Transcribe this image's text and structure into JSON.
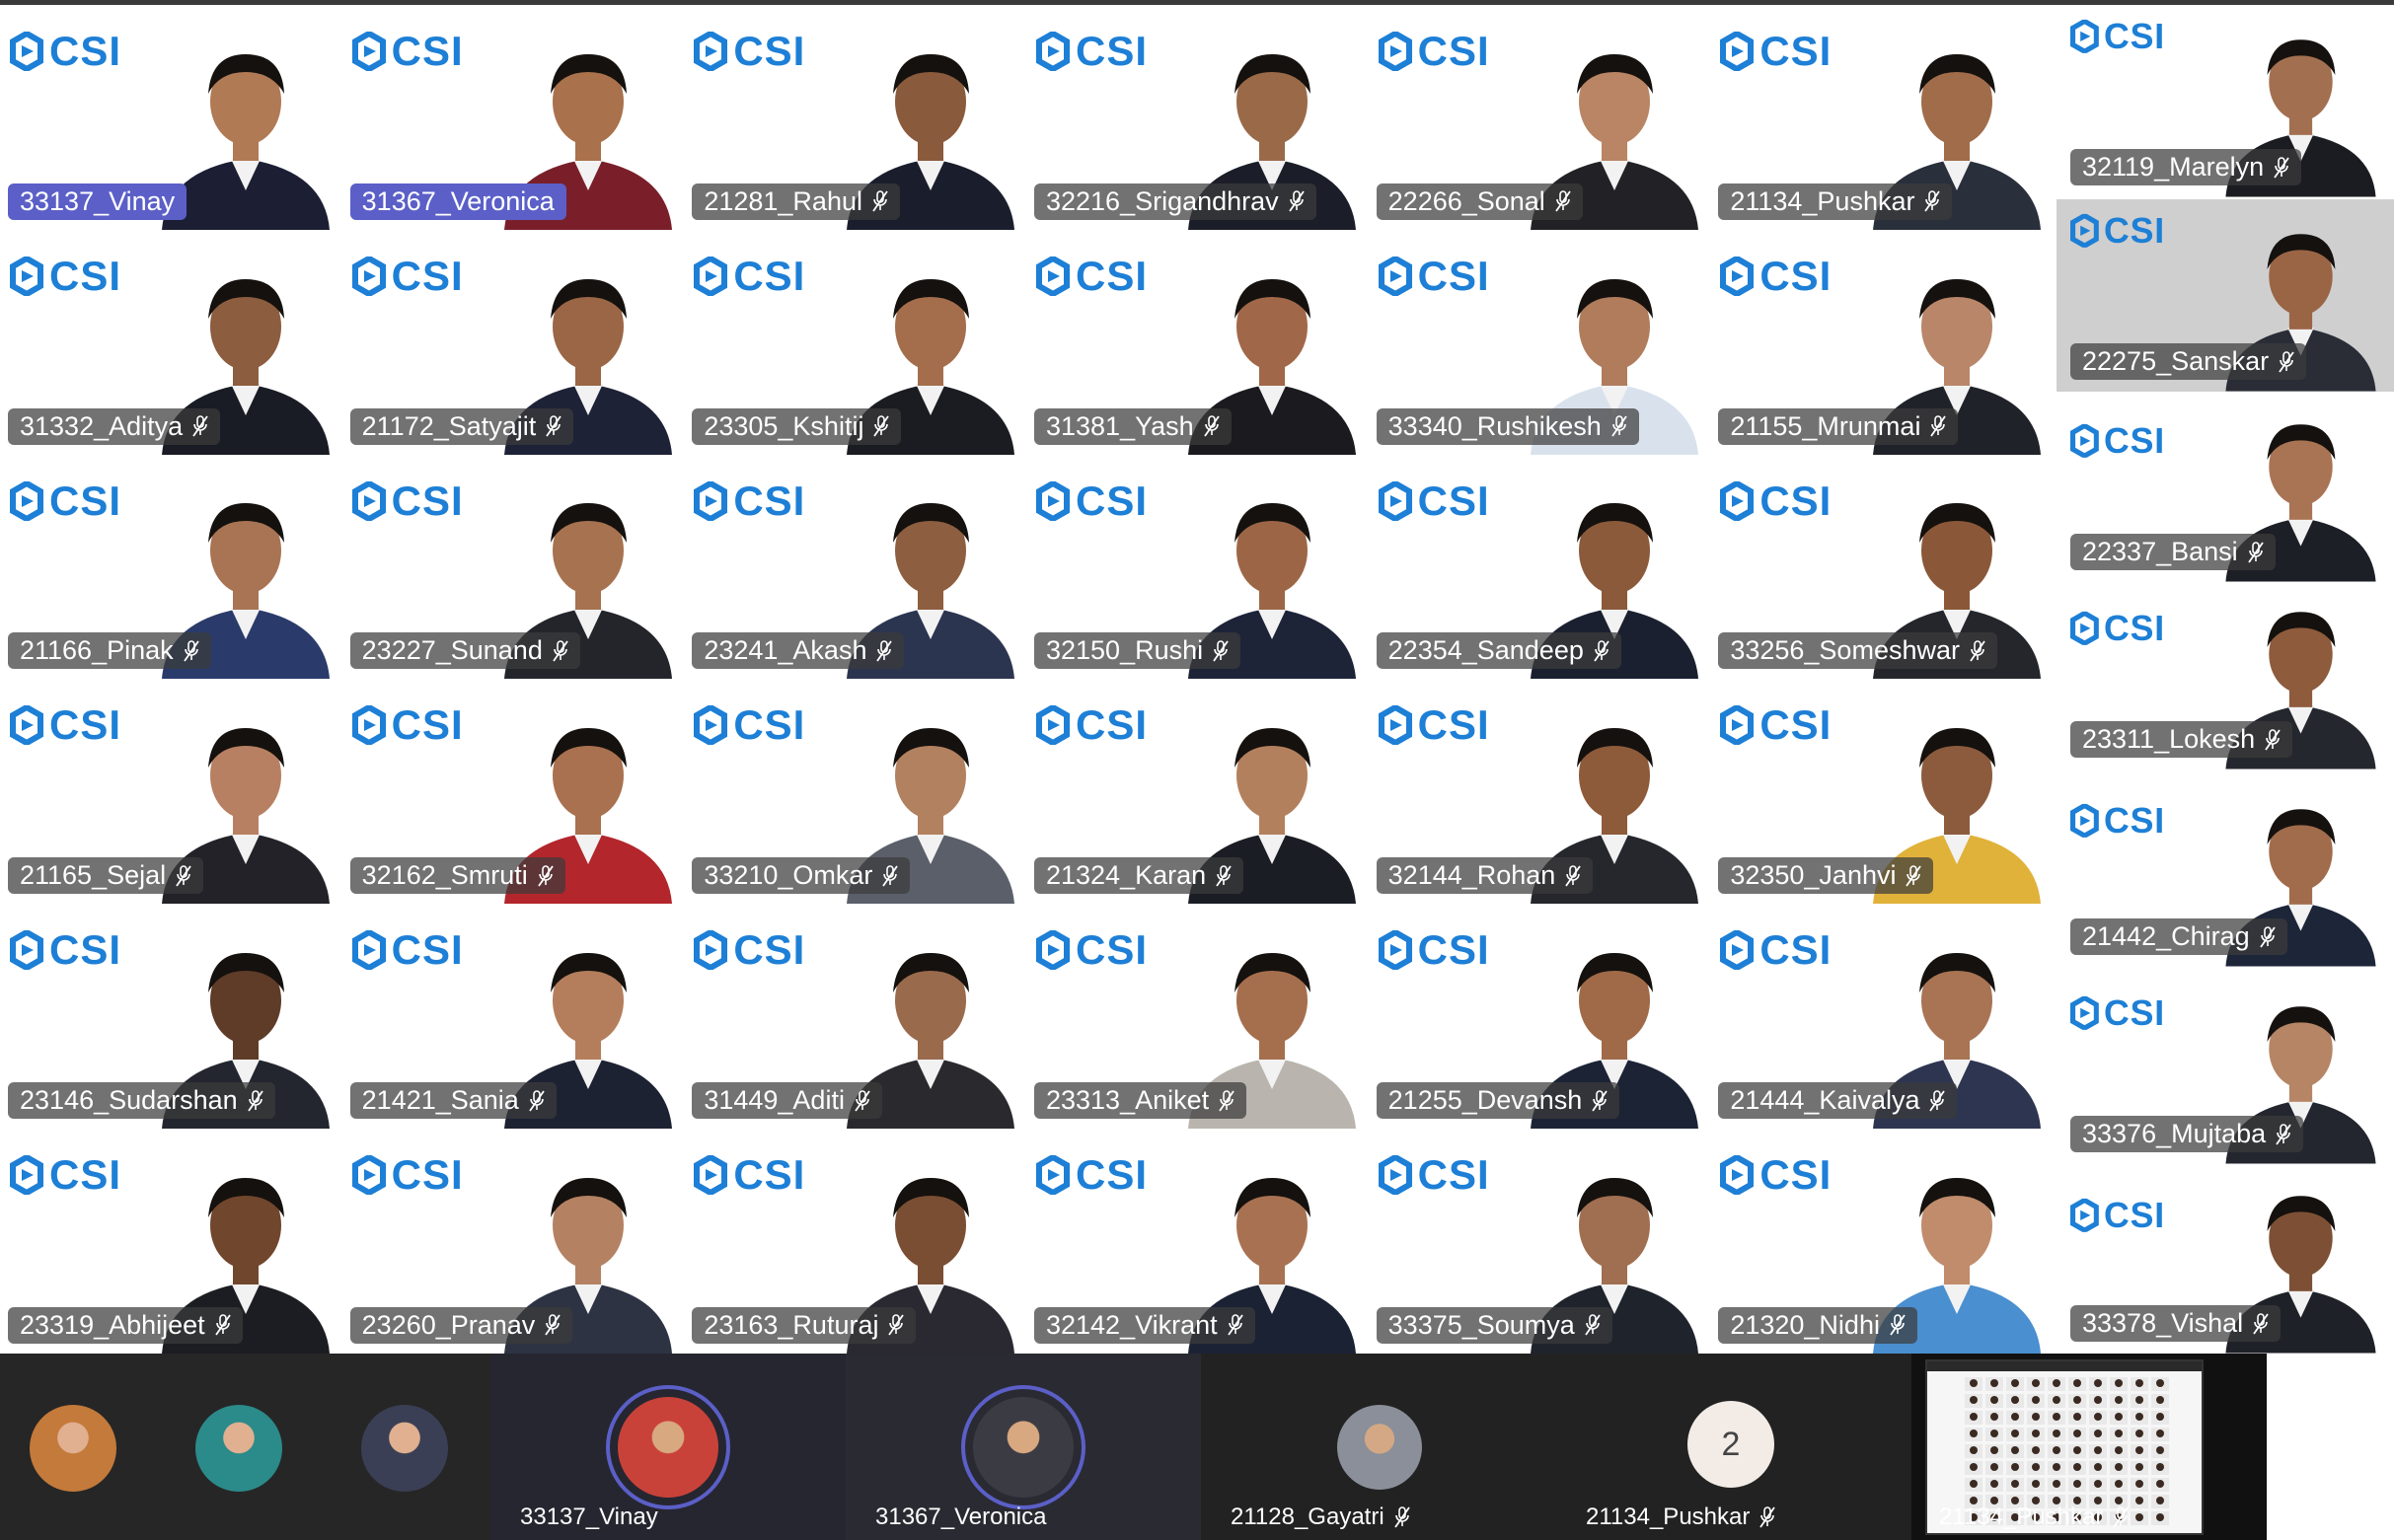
{
  "brand": {
    "logo_text": "CSI",
    "logo_color": "#1d7fd6",
    "speaking_color": "#5b5fc7"
  },
  "grid": [
    {
      "name": "33137_Vinay",
      "speaking": true,
      "muted": false,
      "shirt": "#1c1f33",
      "skin": "#b07a55"
    },
    {
      "name": "31367_Veronica",
      "speaking": true,
      "muted": false,
      "shirt": "#7a1f2a",
      "skin": "#a9714c"
    },
    {
      "name": "21281_Rahul",
      "speaking": false,
      "muted": true,
      "shirt": "#1a1e2c",
      "skin": "#8a5a3c"
    },
    {
      "name": "32216_Srigandhrav",
      "speaking": false,
      "muted": true,
      "shirt": "#1b1e28",
      "skin": "#9a6a48"
    },
    {
      "name": "22266_Sonal",
      "speaking": false,
      "muted": true,
      "shirt": "#222226",
      "skin": "#b98564"
    },
    {
      "name": "21134_Pushkar",
      "speaking": false,
      "muted": true,
      "shirt": "#2a2f3c",
      "skin": "#a06c4a"
    },
    {
      "name": "31332_Aditya",
      "speaking": false,
      "muted": true,
      "shirt": "#191c24",
      "skin": "#8c5d3f"
    },
    {
      "name": "21172_Satyajit",
      "speaking": false,
      "muted": true,
      "shirt": "#1d2236",
      "skin": "#9a6646"
    },
    {
      "name": "23305_Kshitij",
      "speaking": false,
      "muted": true,
      "shirt": "#1a1c22",
      "skin": "#a46e4c"
    },
    {
      "name": "31381_Yash",
      "speaking": false,
      "muted": true,
      "shirt": "#1a1a1f",
      "skin": "#a06848"
    },
    {
      "name": "33340_Rushikesh",
      "speaking": false,
      "muted": true,
      "shirt": "#d9e2ec",
      "skin": "#b07c5c"
    },
    {
      "name": "21155_Mrunmai",
      "speaking": false,
      "muted": true,
      "shirt": "#20222a",
      "skin": "#b9866a"
    },
    {
      "name": "21166_Pinak",
      "speaking": false,
      "muted": true,
      "shirt": "#2a3a6a",
      "skin": "#a87453"
    },
    {
      "name": "23227_Sunand",
      "speaking": false,
      "muted": true,
      "shirt": "#23252b",
      "skin": "#a77250"
    },
    {
      "name": "23241_Akash",
      "speaking": false,
      "muted": true,
      "shirt": "#2b3550",
      "skin": "#8e5e40"
    },
    {
      "name": "32150_Rushi",
      "speaking": false,
      "muted": true,
      "shirt": "#1d2438",
      "skin": "#9c6646"
    },
    {
      "name": "22354_Sandeep",
      "speaking": false,
      "muted": true,
      "shirt": "#1b2030",
      "skin": "#8b5a3b"
    },
    {
      "name": "33256_Someshwar",
      "speaking": false,
      "muted": true,
      "shirt": "#25262c",
      "skin": "#8a5838"
    },
    {
      "name": "21165_Sejal",
      "speaking": false,
      "muted": true,
      "shirt": "#222228",
      "skin": "#b88062"
    },
    {
      "name": "32162_Smruti",
      "speaking": false,
      "muted": true,
      "shirt": "#b3262b",
      "skin": "#a9714f"
    },
    {
      "name": "33210_Omkar",
      "speaking": false,
      "muted": true,
      "shirt": "#5a5f6a",
      "skin": "#b28160"
    },
    {
      "name": "21324_Karan",
      "speaking": false,
      "muted": true,
      "shirt": "#1b1d25",
      "skin": "#b3805e"
    },
    {
      "name": "32144_Rohan",
      "speaking": false,
      "muted": true,
      "shirt": "#25272d",
      "skin": "#8d5a3a"
    },
    {
      "name": "32350_Janhvi",
      "speaking": false,
      "muted": true,
      "shirt": "#e0b23a",
      "skin": "#8c5b3d"
    },
    {
      "name": "23146_Sudarshan",
      "speaking": false,
      "muted": true,
      "shirt": "#23262e",
      "skin": "#5e3c28"
    },
    {
      "name": "21421_Sania",
      "speaking": false,
      "muted": true,
      "shirt": "#1d2233",
      "skin": "#b47e5c"
    },
    {
      "name": "31449_Aditi",
      "speaking": false,
      "muted": true,
      "shirt": "#2a2a2e",
      "skin": "#9a6a4c"
    },
    {
      "name": "23313_Aniket",
      "speaking": false,
      "muted": true,
      "shirt": "#b9b5ae",
      "skin": "#a56f4e"
    },
    {
      "name": "21255_Devansh",
      "speaking": false,
      "muted": true,
      "shirt": "#1c2335",
      "skin": "#a06a48"
    },
    {
      "name": "21444_Kaivalya",
      "speaking": false,
      "muted": true,
      "shirt": "#2d3550",
      "skin": "#a87454"
    },
    {
      "name": "23319_Abhijeet",
      "speaking": false,
      "muted": true,
      "shirt": "#1c1d22",
      "skin": "#70462d"
    },
    {
      "name": "23260_Pranav",
      "speaking": false,
      "muted": true,
      "shirt": "#2d3342",
      "skin": "#b48262"
    },
    {
      "name": "23163_Ruturaj",
      "speaking": false,
      "muted": true,
      "shirt": "#2a2830",
      "skin": "#7a4e33"
    },
    {
      "name": "32142_Vikrant",
      "speaking": false,
      "muted": true,
      "shirt": "#1b2234",
      "skin": "#a87252"
    },
    {
      "name": "33375_Soumya",
      "speaking": false,
      "muted": true,
      "shirt": "#1f232c",
      "skin": "#a06e50"
    },
    {
      "name": "21320_Nidhi",
      "speaking": false,
      "muted": true,
      "shirt": "#4a8fcf",
      "skin": "#c08c6c"
    }
  ],
  "side": [
    {
      "name": "32119_Marelyn",
      "muted": true,
      "shirt": "#1b1c22",
      "skin": "#a27050",
      "dark_bg": false
    },
    {
      "name": "22275_Sanskar",
      "muted": true,
      "shirt": "#2a2d36",
      "skin": "#9a6545",
      "dark_bg": true
    },
    {
      "name": "22337_Bansi",
      "muted": true,
      "shirt": "#1d1f26",
      "skin": "#a97454",
      "dark_bg": false
    },
    {
      "name": "23311_Lokesh",
      "muted": true,
      "shirt": "#25272e",
      "skin": "#8e5b3c",
      "dark_bg": false
    },
    {
      "name": "21442_Chirag",
      "muted": true,
      "shirt": "#1d2538",
      "skin": "#a16c4b",
      "dark_bg": false
    },
    {
      "name": "33376_Mujtaba",
      "muted": true,
      "shirt": "#23262e",
      "skin": "#b58565",
      "dark_bg": false
    },
    {
      "name": "33378_Vishal",
      "muted": true,
      "shirt": "#1f2128",
      "skin": "#7d5035",
      "dark_bg": false
    }
  ],
  "bottom_bar": {
    "avatars": [
      {
        "icon": "participant-avatar-1-icon",
        "color": "#c47a3a"
      },
      {
        "icon": "participant-avatar-2-icon",
        "color": "#2b8a8a"
      },
      {
        "icon": "participant-avatar-3-icon",
        "color": "#3a3f55"
      }
    ],
    "speakers": [
      {
        "name": "33137_Vinay",
        "muted": false,
        "color": "#c9423a"
      },
      {
        "name": "31367_Veronica",
        "muted": false,
        "color": "#3b3b44"
      }
    ],
    "others": [
      {
        "name": "21128_Gayatri",
        "muted": true,
        "color": "#8a8f99"
      },
      {
        "name": "21134_Pushkar",
        "muted": true,
        "badge": "2"
      }
    ],
    "self_view": {
      "name": "21134_Pushkar",
      "muted": true
    }
  }
}
